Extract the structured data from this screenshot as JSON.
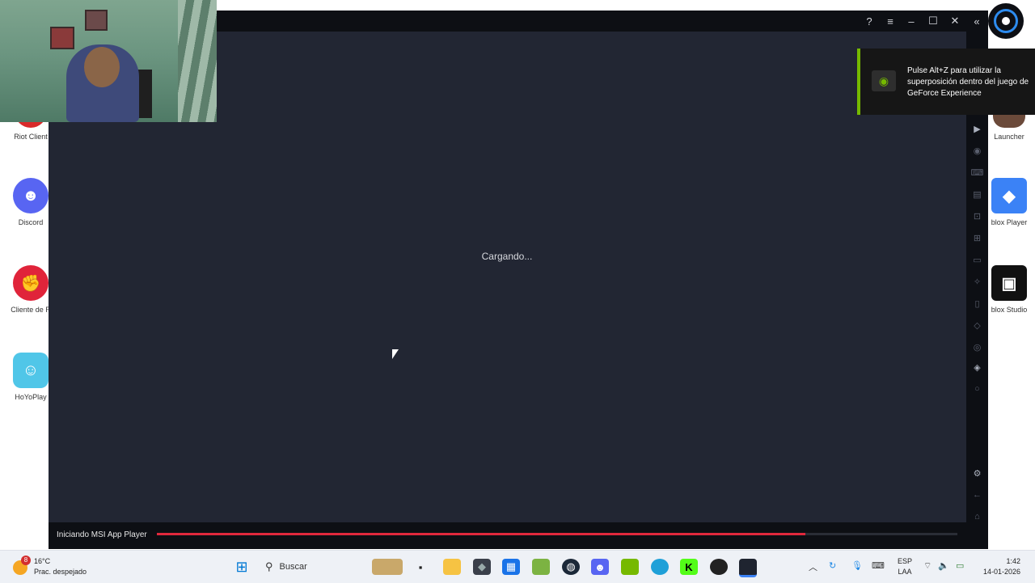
{
  "desktop": {
    "icons": [
      {
        "label": "Riot Client",
        "color": "#d92a2a",
        "glyph": "R"
      },
      {
        "label": "Discord",
        "color": "#5865f2",
        "glyph": "D"
      },
      {
        "label": "Cliente de R",
        "color": "#e0243a",
        "glyph": "✊"
      },
      {
        "label": "HoYoPlay",
        "color": "#50c6e8",
        "glyph": "☺"
      }
    ],
    "right_icons": [
      {
        "label": "Launcher",
        "color": "#6b4a3a",
        "glyph": ""
      },
      {
        "label": "blox Player",
        "color": "#3b82f6",
        "glyph": "◆"
      },
      {
        "label": "blox Studio",
        "color": "#111111",
        "glyph": "▣"
      }
    ]
  },
  "window": {
    "loading_text": "Cargando...",
    "progress_label": "Iniciando MSI App Player",
    "progress": 0.81,
    "accent": "#e0283c",
    "titlebar_buttons": [
      "help-icon",
      "menu-icon",
      "minimize-icon",
      "maximize-icon",
      "close-icon",
      "collapse-icon"
    ],
    "sidebar_icons": [
      "play-icon",
      "record-icon",
      "keyboard-icon",
      "apk-icon",
      "screenshot-icon",
      "macro-icon",
      "folder-icon",
      "rotate-icon",
      "shake-icon",
      "location-icon",
      "multi-instance-icon",
      "layers-icon",
      "eco-icon",
      "settings-icon",
      "back-icon",
      "home-icon",
      "recent-icon"
    ]
  },
  "geforce": {
    "message": "Pulse Alt+Z para utilizar la superposición dentro del juego de GeForce Experience",
    "accent": "#76b900"
  },
  "taskbar": {
    "weather_temp": "16°C",
    "weather_desc": "Prac. despejado",
    "weather_badge": "8",
    "search_placeholder": "Buscar",
    "lang_line1": "ESP",
    "lang_line2": "LAA",
    "time": "1:42",
    "date": "14-01-2026"
  }
}
